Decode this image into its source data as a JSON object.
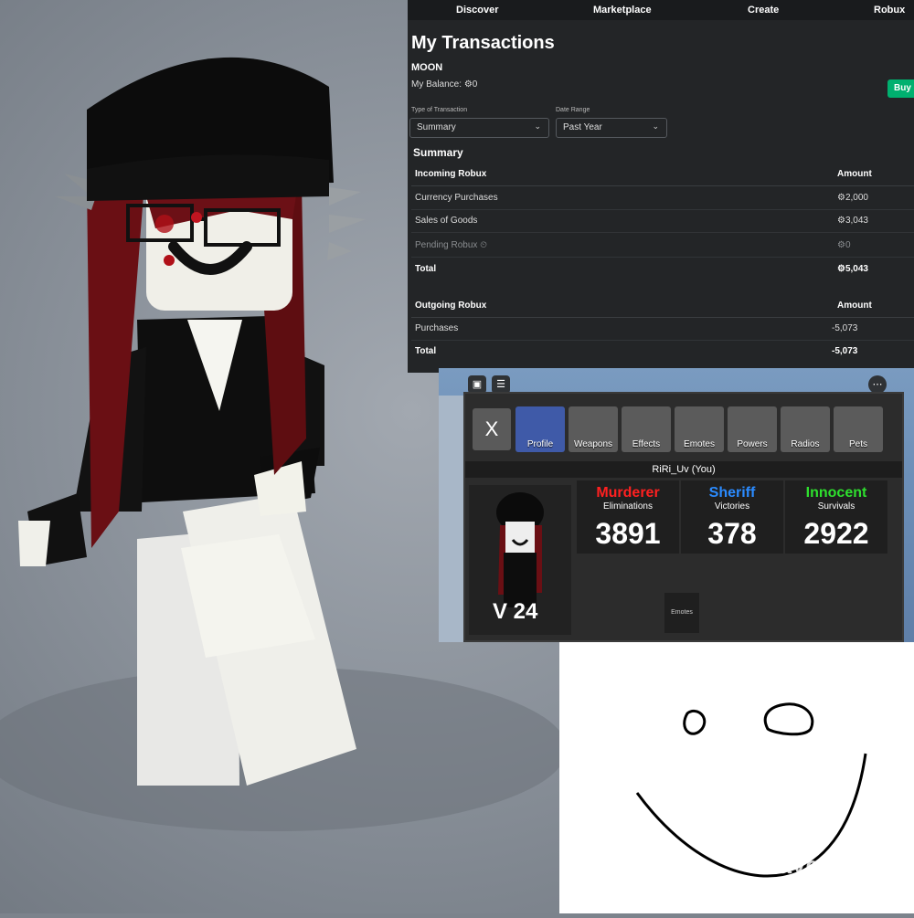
{
  "transactions": {
    "nav": [
      "Discover",
      "Marketplace",
      "Create",
      "Robux"
    ],
    "title": "My Transactions",
    "username": "MOON",
    "balance_label": "My Balance:",
    "balance_value": "0",
    "buy_label": "Buy",
    "type_label": "Type of Transaction",
    "type_value": "Summary",
    "range_label": "Date Range",
    "range_value": "Past Year",
    "summary_heading": "Summary",
    "incoming": {
      "heading": "Incoming Robux",
      "amount_header": "Amount",
      "rows": [
        {
          "label": "Currency Purchases",
          "amount": "2,000"
        },
        {
          "label": "Sales of Goods",
          "amount": "3,043"
        },
        {
          "label": "Pending Robux",
          "amount": "0"
        }
      ],
      "total_label": "Total",
      "total_amount": "5,043"
    },
    "outgoing": {
      "heading": "Outgoing Robux",
      "amount_header": "Amount",
      "rows": [
        {
          "label": "Purchases",
          "amount": "-5,073"
        }
      ],
      "total_label": "Total",
      "total_amount": "-5,073"
    }
  },
  "game": {
    "close_label": "X",
    "tabs": [
      "Profile",
      "Weapons",
      "Effects",
      "Emotes",
      "Powers",
      "Radios",
      "Pets"
    ],
    "player_name": "RiRi_Uv (You)",
    "stats": [
      {
        "title": "Murderer",
        "subtitle": "Eliminations",
        "value": "3891",
        "color": "#ff2020"
      },
      {
        "title": "Sheriff",
        "subtitle": "Victories",
        "value": "378",
        "color": "#2b8bff"
      },
      {
        "title": "Innocent",
        "subtitle": "Survivals",
        "value": "2922",
        "color": "#2ee02e"
      }
    ],
    "level": "V 24",
    "emotes_label": "Emotes"
  },
  "watermark": "Playerok"
}
